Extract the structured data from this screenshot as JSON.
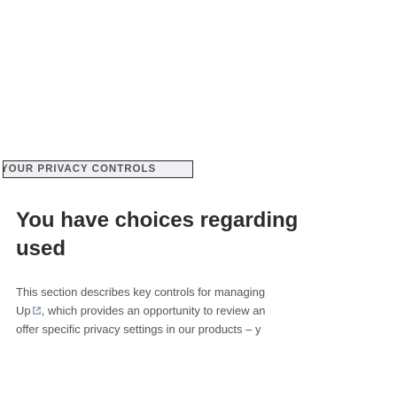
{
  "section_tag": "YOUR PRIVACY CONTROLS",
  "heading": {
    "line1": "You have choices regarding",
    "line2": "used"
  },
  "body": {
    "line1": "This section describes key controls for managing",
    "line2_link": "Up",
    "line2_rest": ", which provides an opportunity to review an",
    "line3": "offer specific privacy settings in our products – y",
    "link_icon": "external-link-icon"
  }
}
